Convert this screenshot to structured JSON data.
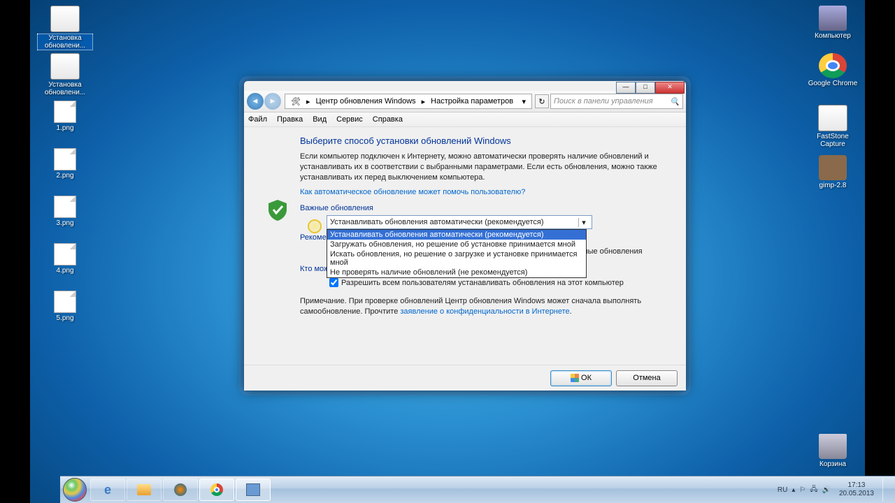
{
  "desktop_icons_left": [
    {
      "label": "Установка обновлени...",
      "sel": true
    },
    {
      "label": "Установка обновлени..."
    },
    {
      "label": "1.png"
    },
    {
      "label": "2.png"
    },
    {
      "label": "3.png"
    },
    {
      "label": "4.png"
    },
    {
      "label": "5.png"
    }
  ],
  "desktop_icons_right": [
    {
      "label": "Компьютер"
    },
    {
      "label": "Google Chrome"
    },
    {
      "label": "FastStone Capture"
    },
    {
      "label": "gimp-2.8"
    }
  ],
  "trash_label": "Корзина",
  "breadcrumb": {
    "a": "Центр обновления Windows",
    "b": "Настройка параметров"
  },
  "search_placeholder": "Поиск в панели управления",
  "menus": [
    "Файл",
    "Правка",
    "Вид",
    "Сервис",
    "Справка"
  ],
  "heading": "Выберите способ установки обновлений Windows",
  "para": "Если компьютер подключен к Интернету, можно автоматически проверять наличие обновлений и устанавливать их в соответствии с выбранными параметрами. Если есть обновления, можно также устанавливать их перед выключением компьютера.",
  "help_link": "Как автоматическое обновление может помочь пользователю?",
  "section_important": "Важные обновления",
  "combo_selected": "Устанавливать обновления автоматически (рекомендуется)",
  "combo_options": [
    "Устанавливать обновления автоматически (рекомендуется)",
    "Загружать обновления, но решение об установке принимается мной",
    "Искать обновления, но решение о загрузке и установке принимается мной",
    "Не проверять наличие обновлений (не рекомендуется)"
  ],
  "section_recommended": "Рекомендуемые обновления",
  "chk1": "Получать рекомендуемые обновления таким же образом, как и важные обновления",
  "section_who": "Кто может устанавливать обновления",
  "chk2": "Разрешить всем пользователям устанавливать обновления на этот компьютер",
  "note_a": "Примечание. При проверке обновлений Центр обновления Windows может сначала выполнять самообновление. Прочтите ",
  "note_link": "заявление о конфиденциальности в Интернете",
  "btn_ok": "ОК",
  "btn_cancel": "Отмена",
  "win_min": "—",
  "win_max": "□",
  "win_close": "✕",
  "tray": {
    "lang": "RU",
    "time": "17:13",
    "date": "20.05.2013"
  }
}
